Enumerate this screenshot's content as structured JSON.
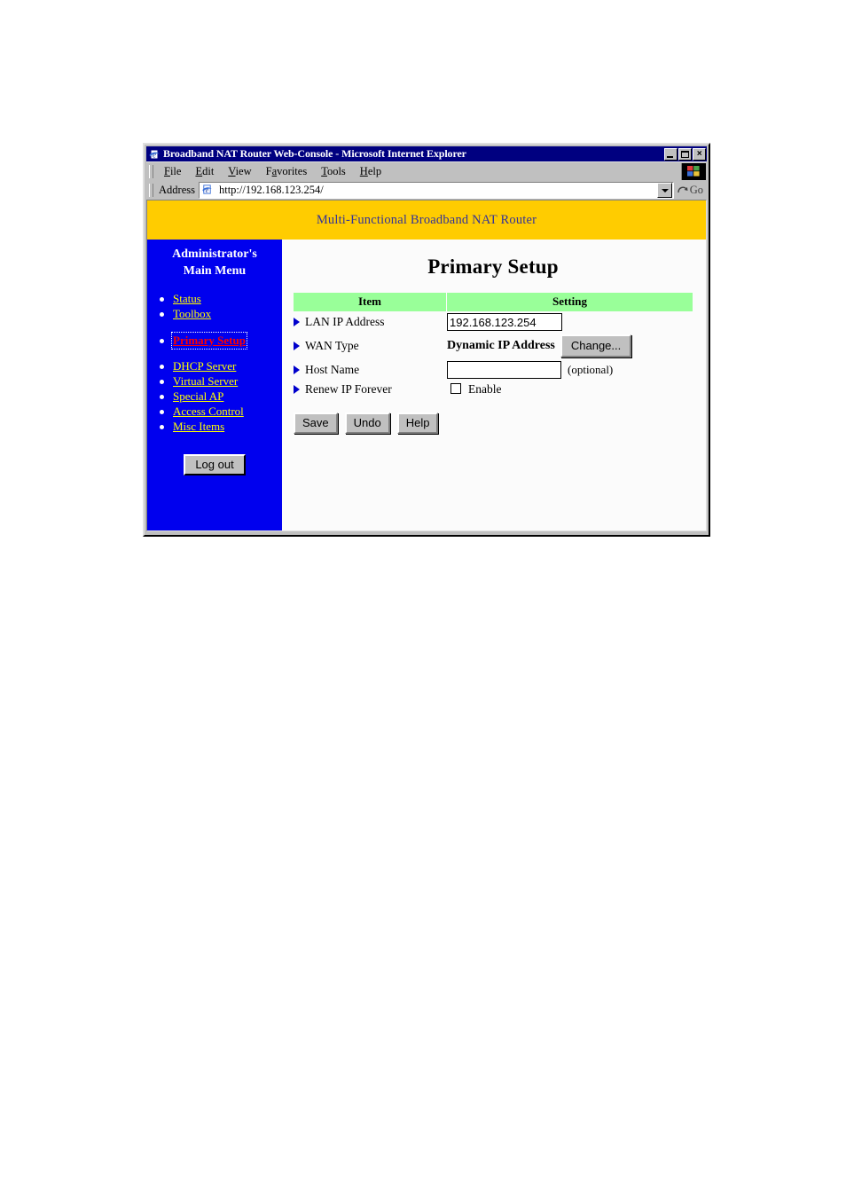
{
  "window": {
    "title": "Broadband NAT Router Web-Console - Microsoft Internet Explorer",
    "app_icon": "ie-logo-icon",
    "controls": {
      "minimize": "minimize-button",
      "maximize": "maximize-button",
      "close_glyph": "×"
    }
  },
  "menubar": {
    "items": [
      {
        "label": "File",
        "accel": "F"
      },
      {
        "label": "Edit",
        "accel": "E"
      },
      {
        "label": "View",
        "accel": "V"
      },
      {
        "label": "Favorites",
        "accel": "a"
      },
      {
        "label": "Tools",
        "accel": "T"
      },
      {
        "label": "Help",
        "accel": "H"
      }
    ]
  },
  "addressbar": {
    "label": "Address",
    "url": "http://192.168.123.254/",
    "placeholder": "http://",
    "go_label": "Go"
  },
  "page": {
    "banner_title": "Multi-Functional Broadband NAT Router",
    "banner_bg": "#ffcc00",
    "banner_fg": "#333399"
  },
  "sidebar": {
    "bg": "#0000ee",
    "heading_line1": "Administrator's",
    "heading_line2": "Main Menu",
    "link_color": "#ffff00",
    "active_color": "#ff0000",
    "groups": [
      {
        "items": [
          {
            "label": "Status",
            "active": false
          },
          {
            "label": "Toolbox",
            "active": false
          }
        ]
      },
      {
        "items": [
          {
            "label": "Primary Setup",
            "active": true
          }
        ]
      },
      {
        "items": [
          {
            "label": "DHCP Server",
            "active": false
          },
          {
            "label": "Virtual Server",
            "active": false
          },
          {
            "label": "Special AP",
            "active": false
          },
          {
            "label": "Access Control",
            "active": false
          },
          {
            "label": "Misc Items",
            "active": false
          }
        ]
      }
    ],
    "logout_label": "Log out"
  },
  "main": {
    "title": "Primary Setup",
    "table": {
      "header_bg": "#99ff99",
      "columns": [
        "Item",
        "Setting"
      ],
      "rows": [
        {
          "item": "LAN IP Address",
          "control": "text",
          "value": "192.168.123.254"
        },
        {
          "item": "WAN Type",
          "control": "label-button",
          "value": "Dynamic IP Address",
          "button": "Change..."
        },
        {
          "item": "Host Name",
          "control": "text",
          "value": "",
          "note": "(optional)"
        },
        {
          "item": "Renew IP Forever",
          "control": "checkbox",
          "checked": false,
          "checkbox_label": "Enable"
        }
      ]
    },
    "buttons": [
      {
        "label": "Save"
      },
      {
        "label": "Undo"
      },
      {
        "label": "Help"
      }
    ]
  }
}
